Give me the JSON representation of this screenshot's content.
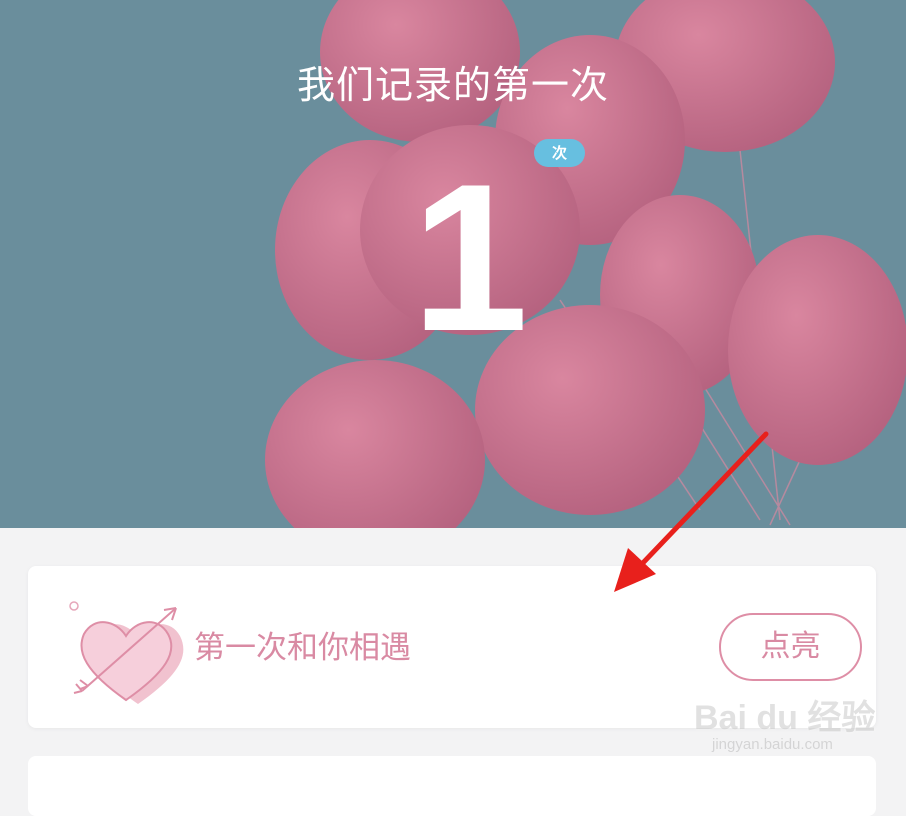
{
  "hero": {
    "title": "我们记录的第一次",
    "count": "1",
    "count_unit": "次"
  },
  "firsts": [
    {
      "label": "第一次和你相遇",
      "button_label": "点亮",
      "icon": "heart-arrow-icon"
    }
  ],
  "colors": {
    "hero_background": "#6a8e9c",
    "balloon": "#c46f8c",
    "accent_pink": "#d98aa3",
    "badge_blue": "#67bfe0",
    "annotation_arrow": "#e8201c"
  },
  "watermark": {
    "brand": "Bai du 经验",
    "url": "jingyan.baidu.com"
  }
}
